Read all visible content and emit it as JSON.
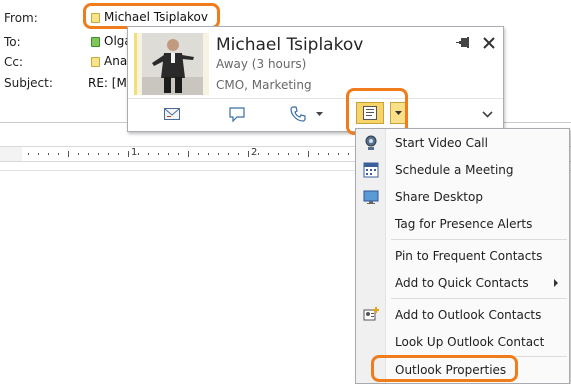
{
  "header": {
    "from_label": "From:",
    "to_label": "To:",
    "cc_label": "Cc:",
    "subject_label": "Subject:",
    "from_value": "Michael Tsiplakov",
    "to_value": "Olga",
    "cc_value": "Ana",
    "subject_value": "RE: [M"
  },
  "contact_card": {
    "name": "Michael Tsiplakov",
    "status": "Away (3 hours)",
    "title": "CMO, Marketing",
    "pin_icon": "pin-icon",
    "close_icon": "close-icon",
    "buttons": [
      "email-icon",
      "im-icon",
      "phone-icon",
      "contact-card-icon",
      "expand-icon"
    ]
  },
  "ruler": {
    "numbers": [
      "1",
      "2"
    ]
  },
  "menu": {
    "items": [
      {
        "label": "Start Video Call",
        "icon": "video-call-icon"
      },
      {
        "label": "Schedule a Meeting",
        "icon": "calendar-icon"
      },
      {
        "label": "Share Desktop",
        "icon": "desktop-icon"
      },
      {
        "label": "Tag for Presence Alerts",
        "icon": ""
      },
      {
        "label": "Pin to Frequent Contacts",
        "icon": ""
      },
      {
        "label": "Add to Quick Contacts",
        "icon": ""
      },
      {
        "label": "Add to Outlook Contacts",
        "icon": "add-contact-icon"
      },
      {
        "label": "Look Up Outlook Contact",
        "icon": ""
      },
      {
        "label": "Outlook Properties",
        "icon": ""
      }
    ]
  },
  "colors": {
    "highlight": "#f07c1c",
    "presence_away": "#f4e58c",
    "presence_available": "#7fc65b"
  }
}
